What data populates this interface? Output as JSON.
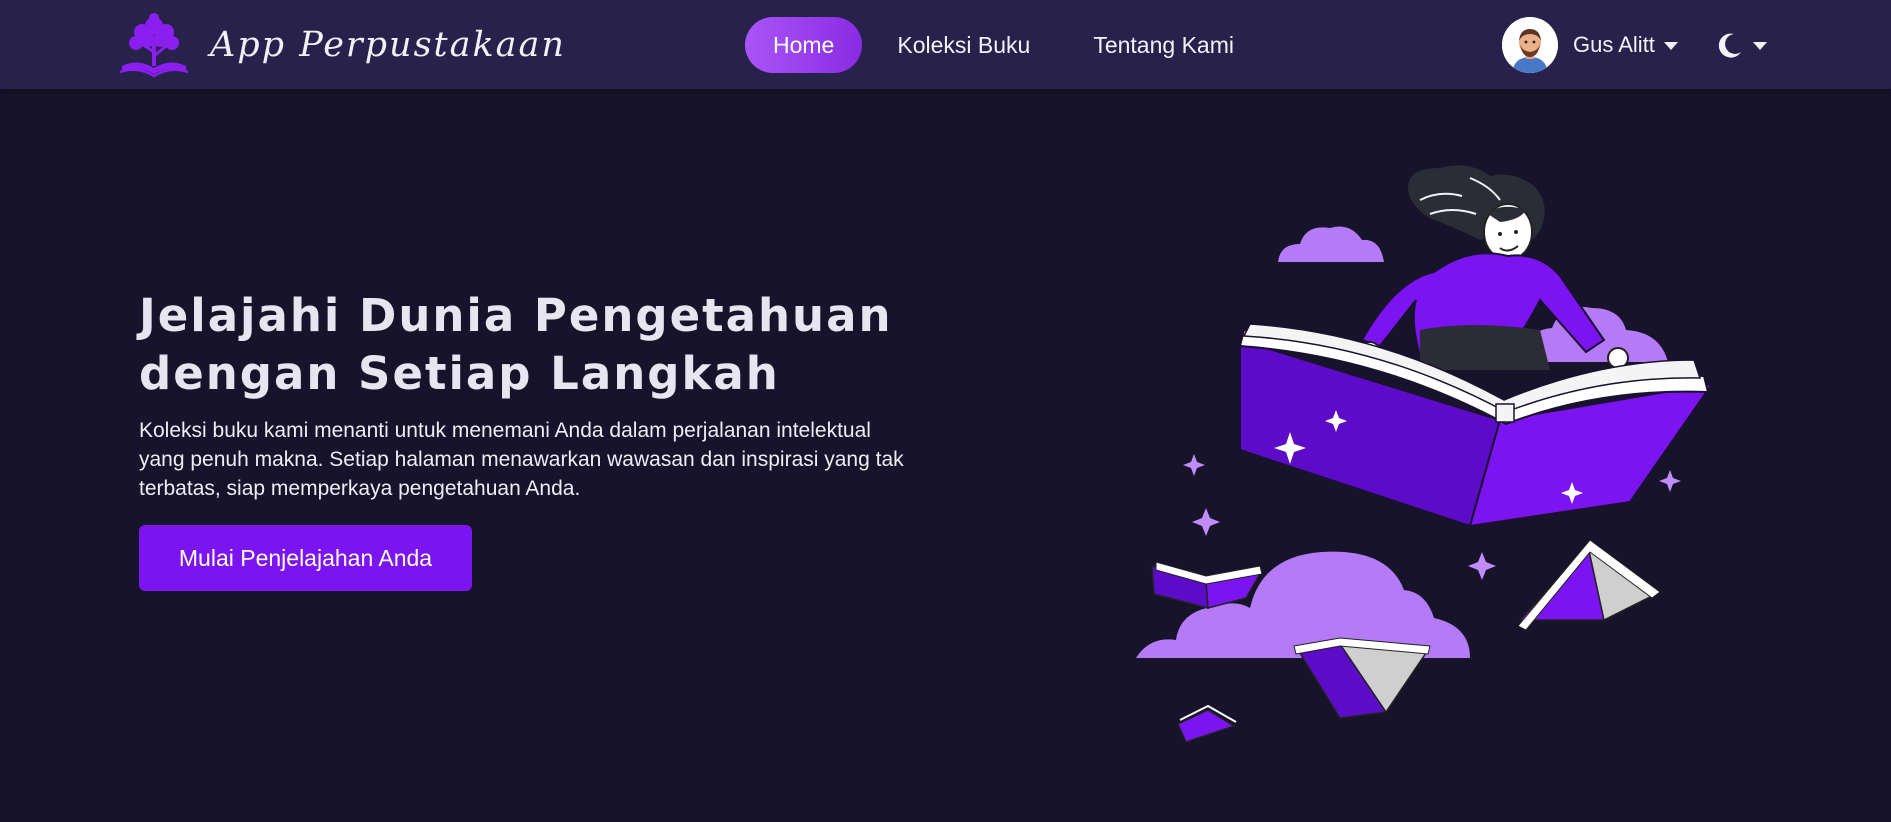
{
  "navbar": {
    "brand": "App Perpustakaan",
    "brand_icon": "tree-book-logo-icon",
    "links": [
      {
        "label": "Home",
        "active": true
      },
      {
        "label": "Koleksi Buku",
        "active": false
      },
      {
        "label": "Tentang Kami",
        "active": false
      }
    ],
    "user": {
      "name": "Gus Alitt",
      "avatar_icon": "avatar-icon",
      "dropdown_icon": "caret-down-icon"
    },
    "theme_toggle": {
      "icon": "moon-icon",
      "dropdown_icon": "caret-down-icon"
    }
  },
  "hero": {
    "title": "Jelajahi Dunia Pengetahuan dengan Setiap Langkah",
    "description": "Koleksi buku kami menanti untuk menemani Anda dalam perjalanan intelektual yang penuh makna. Setiap halaman menawarkan wawasan dan inspirasi yang tak terbatas, siap memperkaya pengetahuan Anda.",
    "cta_label": "Mulai Penjelajahan Anda",
    "illustration": "woman-reading-flying-book-illustration"
  },
  "colors": {
    "background": "#16132b",
    "navbar": "#27214c",
    "accent": "#7c14f2",
    "accent_light": "#a855f7",
    "cloud": "#b57bf6"
  }
}
